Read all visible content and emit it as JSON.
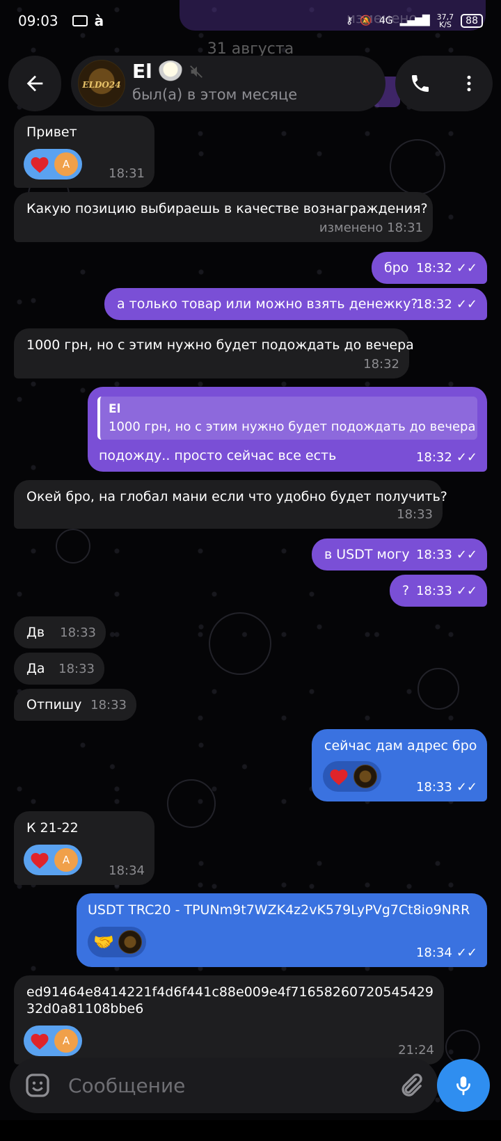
{
  "status": {
    "time": "09:03",
    "speed_top": "37,7",
    "speed_bottom": "K/S",
    "battery": "88",
    "net": "4G"
  },
  "ghost": {
    "date": "31 августа",
    "edited": "изменено"
  },
  "header": {
    "name": "El",
    "status": "был(а) в этом месяце"
  },
  "messages": [
    {
      "id": "m1",
      "dir": "in",
      "text": "Привет",
      "time": "18:31",
      "reaction": "heart",
      "reactor": "A"
    },
    {
      "id": "m2",
      "dir": "in",
      "text": "Какую позицию выбираешь в качестве вознаграждения?",
      "time": "изменено 18:31"
    },
    {
      "id": "m3",
      "dir": "out",
      "text": "бро",
      "time": "18:32"
    },
    {
      "id": "m4",
      "dir": "out",
      "text": "а только товар или можно взять денежку?",
      "time": "18:32"
    },
    {
      "id": "m5",
      "dir": "in",
      "text": "1000 грн, но с этим нужно будет подождать до вечера",
      "time": "18:32"
    },
    {
      "id": "m6",
      "dir": "out",
      "quote_name": "El",
      "quote_text": "1000 грн, но с этим нужно будет подождать до вечера",
      "text": "подожду.. просто сейчас все есть",
      "time": "18:32"
    },
    {
      "id": "m7",
      "dir": "in",
      "text": "Окей бро, на глобал мани если что удобно будет получить?",
      "time": "18:33"
    },
    {
      "id": "m8",
      "dir": "out",
      "text": "в USDT могу",
      "time": "18:33"
    },
    {
      "id": "m9",
      "dir": "out",
      "text": "?",
      "time": "18:33"
    },
    {
      "id": "m10",
      "dir": "in",
      "text": "Дв",
      "time": "18:33"
    },
    {
      "id": "m11",
      "dir": "in",
      "text": "Да",
      "time": "18:33"
    },
    {
      "id": "m12",
      "dir": "in",
      "text": "Отпишу",
      "time": "18:33"
    },
    {
      "id": "m13",
      "dir": "out",
      "text": "сейчас дам адрес бро",
      "time": "18:33",
      "reaction": "heart"
    },
    {
      "id": "m14",
      "dir": "in",
      "text": "К 21-22",
      "time": "18:34",
      "reaction": "heart",
      "reactor": "A"
    },
    {
      "id": "m15",
      "dir": "out",
      "text": "USDT TRC20 - TPUNm9t7WZK4z2vK579LyPVg7Ct8io9NRR",
      "time": "18:34",
      "reaction": "handshake"
    },
    {
      "id": "m16",
      "dir": "in",
      "text": "ed91464e8414221f4d6f441c88e009e4f71658260720545429",
      "text2": "32d0a81108bbe6",
      "time": "21:24",
      "reaction": "heart",
      "reactor": "A"
    }
  ],
  "input": {
    "placeholder": "Сообщение"
  },
  "icons": {
    "back": "arrow-left-icon",
    "call": "phone-icon",
    "menu": "more-vertical-icon",
    "mute": "muted-icon",
    "emoji": "sticker-icon",
    "attach": "paperclip-icon",
    "mic": "microphone-icon",
    "read": "double-check-icon"
  }
}
